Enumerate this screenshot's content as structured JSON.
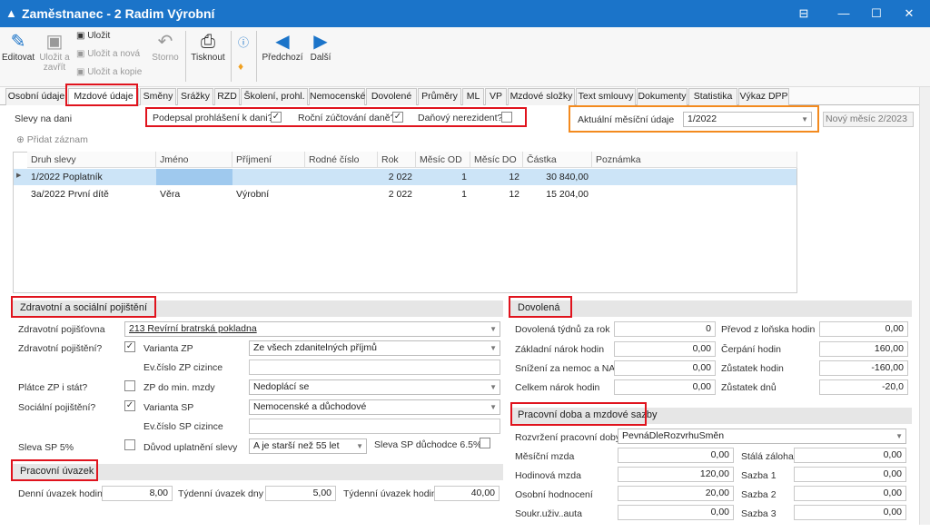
{
  "window": {
    "title": "Zaměstnanec - 2 Radim Výrobní",
    "icon": "app-logo-icon"
  },
  "toolbar": {
    "edit": "Editovat",
    "save_close": "Uložit a zavřít",
    "save": "Uložit",
    "save_new": "Uložit a nová",
    "save_copy": "Uložit a kopie",
    "cancel": "Storno",
    "print": "Tisknout",
    "prev": "Předchozí",
    "next": "Další"
  },
  "tabs": [
    "Osobní údaje",
    "Mzdové údaje",
    "Směny",
    "Srážky",
    "RZD",
    "Školení, prohl.",
    "Nemocenské",
    "Dovolené",
    "Průměry",
    "ML",
    "VP",
    "Mzdové složky",
    "Text smlouvy",
    "Dokumenty",
    "Statistika",
    "Výkaz DPP"
  ],
  "tax": {
    "label": "Slevy na dani",
    "signed": "Podepsal prohlášení k dani?",
    "annual": "Roční zúčtování daně?",
    "nonresident": "Daňový nerezident?",
    "current_label": "Aktuální měsíční údaje",
    "current_value": "1/2022",
    "new_month": "Nový měsíc 2/2023",
    "add_record": "Přidat záznam"
  },
  "grid": {
    "headers": [
      "Druh slevy",
      "Jméno",
      "Příjmení",
      "Rodné číslo",
      "Rok",
      "Měsíc OD",
      "Měsíc DO",
      "Částka",
      "Poznámka"
    ],
    "rows": [
      [
        "1/2022 Poplatník",
        "",
        "",
        "",
        "2 022",
        "1",
        "12",
        "30 840,00",
        ""
      ],
      [
        "3a/2022 První dítě",
        "Věra",
        "Výrobní",
        "",
        "2 022",
        "1",
        "12",
        "15 204,00",
        ""
      ]
    ]
  },
  "health": {
    "title": "Zdravotní a sociální pojištění",
    "insurer_label": "Zdravotní pojišťovna",
    "insurer": "213 Revírní bratrská pokladna",
    "hi_label": "Zdravotní pojištění?",
    "variant_zp": "Varianta ZP",
    "variant_zp_value": "Ze všech zdanitelných příjmů",
    "foreign_zp": "Ev.číslo ZP cizince",
    "payer_label": "Plátce ZP i stát?",
    "zp_min": "ZP do min. mzdy",
    "zp_min_value": "Nedoplácí se",
    "si_label": "Sociální pojištění?",
    "variant_sp": "Varianta SP",
    "variant_sp_value": "Nemocenské a důchodové",
    "foreign_sp": "Ev.číslo SP cizince",
    "sp5": "Sleva SP 5%",
    "reason": "Důvod uplatnění slevy",
    "reason_value": "A je starší než 55 let",
    "sp_pension": "Sleva SP důchodce 6.5%"
  },
  "workload": {
    "title": "Pracovní úvazek",
    "daily": "Denní úvazek hodin",
    "daily_v": "8,00",
    "weekly_days": "Týdenní úvazek dny",
    "weekly_days_v": "5,00",
    "weekly_hours": "Týdenní úvazek hodin",
    "weekly_hours_v": "40,00"
  },
  "vacation": {
    "title": "Dovolená",
    "weeks": "Dovolená týdnů za rok",
    "weeks_v": "0",
    "base": "Základní nárok hodin",
    "base_v": "0,00",
    "reduce": "Snížení za nemoc a NA",
    "reduce_v": "0,00",
    "total": "Celkem nárok hodin",
    "total_v": "0,00",
    "transfer": "Převod z loňska hodin",
    "transfer_v": "0,00",
    "used": "Čerpání hodin",
    "used_v": "160,00",
    "rem_h": "Zůstatek hodin",
    "rem_h_v": "-160,00",
    "rem_d": "Zůstatek dnů",
    "rem_d_v": "-20,0"
  },
  "wage": {
    "title": "Pracovní doba a mzdové sazby",
    "dist": "Rozvržení pracovní doby",
    "dist_v": "PevnáDleRozvrhuSměn",
    "monthly": "Měsíční mzda",
    "monthly_v": "0,00",
    "hourly": "Hodinová mzda",
    "hourly_v": "120,00",
    "personal": "Osobní hodnocení",
    "personal_v": "20,00",
    "car": "Soukr.uživ..auta",
    "car_v": "0,00",
    "adv": "Stálá záloha",
    "adv_v": "0,00",
    "r1": "Sazba 1",
    "r1_v": "0,00",
    "r2": "Sazba 2",
    "r2_v": "0,00",
    "r3": "Sazba 3",
    "r3_v": "0,00"
  },
  "colors": {
    "titlebar": "#1b74c9",
    "highlight": "#e0131d",
    "orange": "#f38a1e",
    "selected_row": "#cce4f7"
  }
}
